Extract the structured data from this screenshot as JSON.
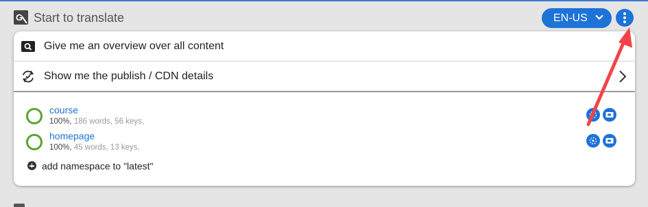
{
  "header": {
    "title": "Start to translate",
    "language_label": "EN-US"
  },
  "menu": {
    "overview_label": "Give me an overview over all content",
    "publish_label": "Show me the publish / CDN details"
  },
  "namespaces": [
    {
      "name": "course",
      "progress": "100%,",
      "stats": "186 words, 56 keys,"
    },
    {
      "name": "homepage",
      "progress": "100%,",
      "stats": "45 words, 13 keys,"
    }
  ],
  "add_namespace_label": "add namespace to \"latest\"",
  "colors": {
    "accent": "#1d73d6",
    "complete_ring": "#5aa332",
    "annotation_arrow": "#f0444a"
  },
  "icons": {
    "logo": "translate-icon",
    "overview": "search-icon",
    "publish": "sync-icon",
    "kebab": "more-vertical-icon"
  }
}
